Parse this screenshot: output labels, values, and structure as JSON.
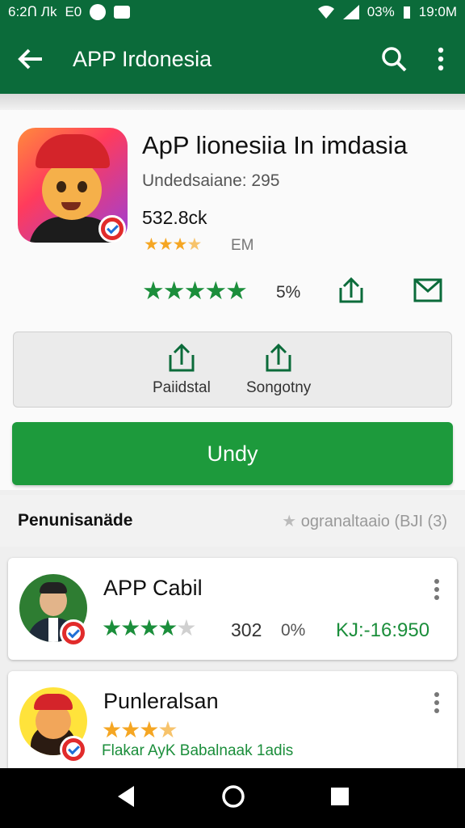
{
  "status_bar": {
    "time_left": "6:2Ո Лk",
    "carrier": "E0",
    "battery": "03%",
    "clock": "19:0M"
  },
  "app_bar": {
    "title": "APP Irdonesia"
  },
  "app": {
    "name": "ApP lionesiia In imdasia",
    "developer": "Undedsaiane: 295",
    "downloads": "532.8ck",
    "rating_stars": 3.5,
    "size_label": "EM",
    "rating_big_stars": 5,
    "percent": "5%"
  },
  "actions": [
    {
      "label": "Paiidstal",
      "icon": "upload-icon"
    },
    {
      "label": "Songotny",
      "icon": "upload-icon"
    }
  ],
  "primary_button": {
    "label": "Undy"
  },
  "section": {
    "title": "Penunisanäde",
    "right": "ogranaltaaio (BJI (3)"
  },
  "list": [
    {
      "title": "APP Cabil",
      "stars": 4,
      "count": "302",
      "percent": "0%",
      "price": "KJ:-16:950"
    },
    {
      "title": "Punleralsan",
      "stars": 3.5,
      "subtitle": "Flakar AyK Babalnaak 1adis"
    }
  ],
  "colors": {
    "primary": "#0b6b3a",
    "accent": "#1d9a3c",
    "star_gold": "#f5a623"
  }
}
